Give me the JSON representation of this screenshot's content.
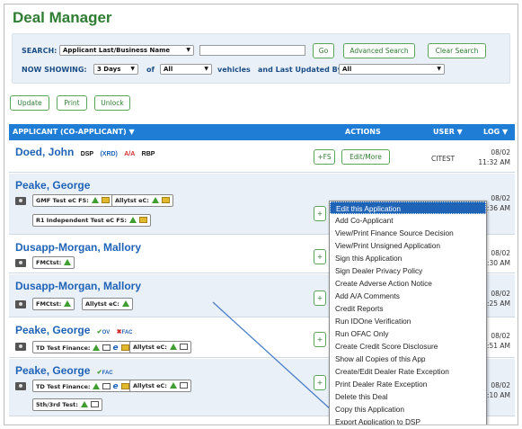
{
  "title": "Deal Manager",
  "search": {
    "label": "SEARCH:",
    "type_value": "Applicant Last/Business Name",
    "go": "Go",
    "advanced": "Advanced Search",
    "clear": "Clear Search"
  },
  "showing": {
    "label": "NOW SHOWING:",
    "days": "3 Days",
    "of": "of",
    "vehicles_value": "All",
    "vehicles_text": "vehicles",
    "updated_by": "and Last Updated By",
    "updated_value": "All"
  },
  "buttons": {
    "update": "Update",
    "print": "Print",
    "unlock": "Unlock"
  },
  "header": {
    "applicant": "APPLICANT (CO-APPLICANT) ▼",
    "actions": "ACTIONS",
    "user": "USER ▼",
    "log": "LOG ▼"
  },
  "rows": [
    {
      "name": "Doed, John",
      "tag1": "DSP",
      "tag2": "(XRD)",
      "tag3": "A/A",
      "tag4": "RBP",
      "fs": "+FS",
      "edit": "Edit/More",
      "user": "CITEST",
      "date": "08/02",
      "time": "11:32 AM"
    },
    {
      "name": "Peake, George",
      "chip1": "GMF Test eC FS:",
      "chip2": "Allytst eC:",
      "chip3": "R1 Independent Test eC FS:",
      "date": "08/02",
      "time": "10:36 AM"
    },
    {
      "name": "Dusapp-Morgan, Mallory",
      "chip1": "FMCtst:",
      "date": "08/02",
      "time": "8:30 AM"
    },
    {
      "name": "Dusapp-Morgan, Mallory",
      "chip1": "FMCtst:",
      "chip2": "Allytst eC:",
      "date": "08/02",
      "time": "8:25 AM"
    },
    {
      "name": "Peake, George",
      "tag1": "OV",
      "tag2": "FAC",
      "chip1": "TD Test Finance:",
      "chip2": "Allytst eC:",
      "date": "08/02",
      "time": "1:51 AM"
    },
    {
      "name": "Peake, George",
      "tag1": "FAC",
      "chip1": "TD Test Finance:",
      "chip2": "Allytst eC:",
      "chip3": "5th/3rd Test:",
      "date": "08/02",
      "time": "2:10 AM"
    }
  ],
  "menu": [
    "Edit this Application",
    "Add Co-Applicant",
    "View/Print Finance Source Decision",
    "View/Print Unsigned Application",
    "Sign this Application",
    "Sign Dealer Privacy Policy",
    "Create Adverse Action Notice",
    "Add A/A Comments",
    "Credit Reports",
    "Run IDOne Verification",
    "Run OFAC Only",
    "Create Credit Score Disclosure",
    "Show all Copies of this App",
    "Create/Edit Dealer Rate Exception",
    "Print Dealer Rate Exception",
    "Delete this Deal",
    "Copy this Application",
    "Export Application to DSP"
  ],
  "colors": {
    "brand_green": "#2e7d32",
    "header_blue": "#1f7dd6",
    "link_blue": "#1f63b7",
    "menu_highlight": "#1f63b7",
    "alert_red": "#d32f2f"
  }
}
